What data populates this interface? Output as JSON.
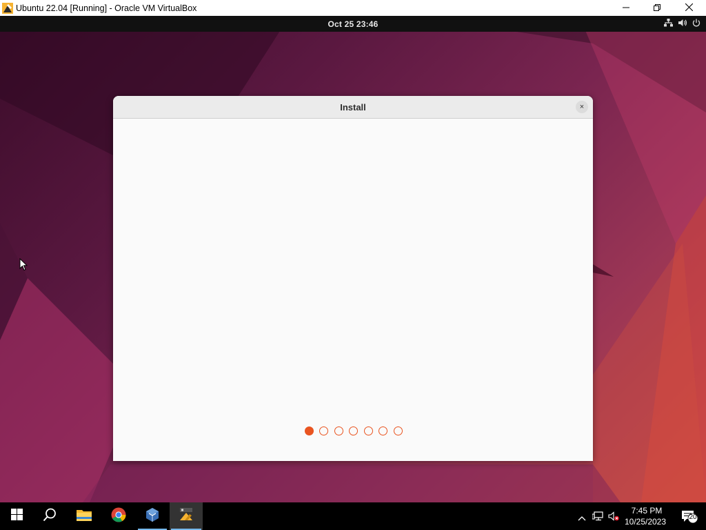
{
  "host_window": {
    "title": "Ubuntu 22.04 [Running] - Oracle VM VirtualBox",
    "minimize_icon": "minimize-icon",
    "restore_icon": "restore-icon",
    "close_icon": "close-icon"
  },
  "guest_topbar": {
    "clock": "Oct 25  23:46",
    "tray_icons": [
      "network-icon",
      "volume-icon",
      "power-icon"
    ]
  },
  "install_dialog": {
    "title": "Install",
    "close_label": "×",
    "steps_total": 7,
    "active_step": 1
  },
  "taskbar": {
    "items": [
      "start-icon",
      "search-icon",
      "file-explorer-icon",
      "chrome-icon",
      "virtualbox-icon",
      "virtualbox-vm-icon"
    ],
    "time": "7:45 PM",
    "date": "10/25/2023",
    "notification_count": "20"
  },
  "colors": {
    "accent": "#e95420",
    "taskbar_active_underline": "#76b9ed"
  }
}
